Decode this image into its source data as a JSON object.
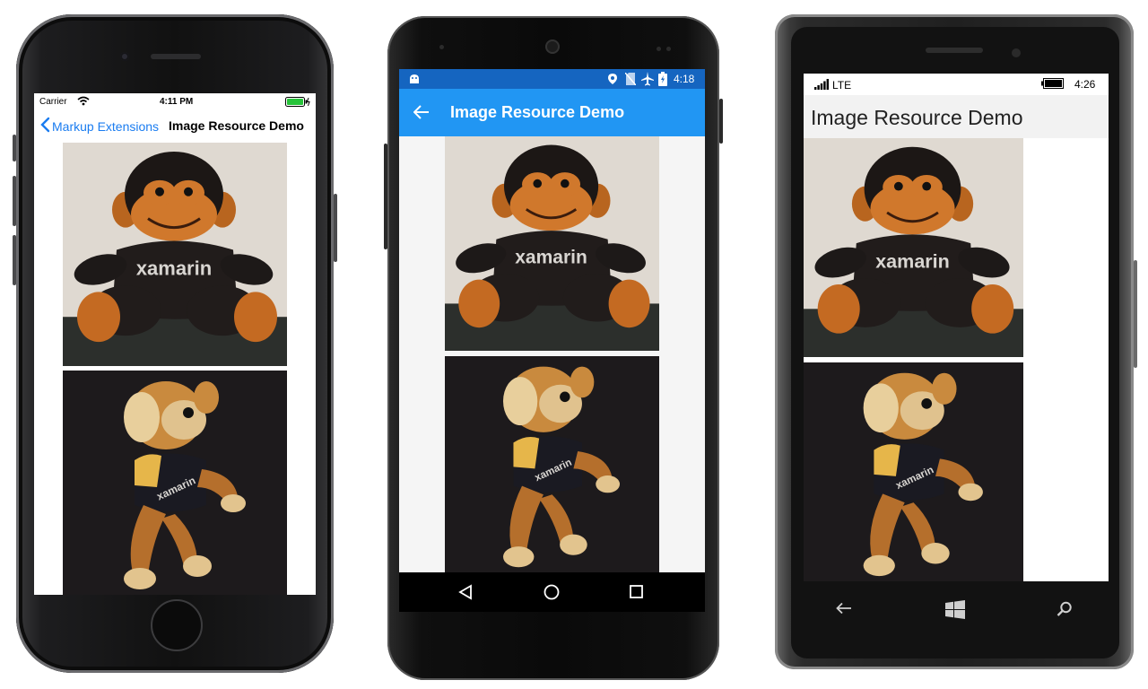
{
  "ios": {
    "status": {
      "carrier": "Carrier",
      "time": "4:11 PM"
    },
    "nav": {
      "back_label": "Markup Extensions",
      "title": "Image Resource Demo"
    }
  },
  "android": {
    "status": {
      "time": "4:18"
    },
    "toolbar": {
      "title": "Image Resource Demo"
    }
  },
  "windows": {
    "status": {
      "network": "LTE",
      "time": "4:26"
    },
    "header": {
      "title": "Image Resource Demo"
    }
  },
  "photos": {
    "monkey1": {
      "shirt_text": "xamarin"
    },
    "monkey2": {
      "shirt_text": "xamarin"
    }
  },
  "colors": {
    "ios_tint": "#1a7cf0",
    "android_primary": "#2196f3",
    "android_primary_dark": "#1565c0",
    "windows_header_bg": "#f2f2f2"
  },
  "icons": [
    "wifi-icon",
    "battery-icon",
    "chevron-left-icon",
    "android-icon",
    "location-icon",
    "no-sim-icon",
    "airplane-icon",
    "back-arrow-icon",
    "nav-back-icon",
    "nav-home-icon",
    "nav-recents-icon",
    "signal-icon",
    "windows-back-icon",
    "windows-start-icon",
    "windows-search-icon"
  ]
}
